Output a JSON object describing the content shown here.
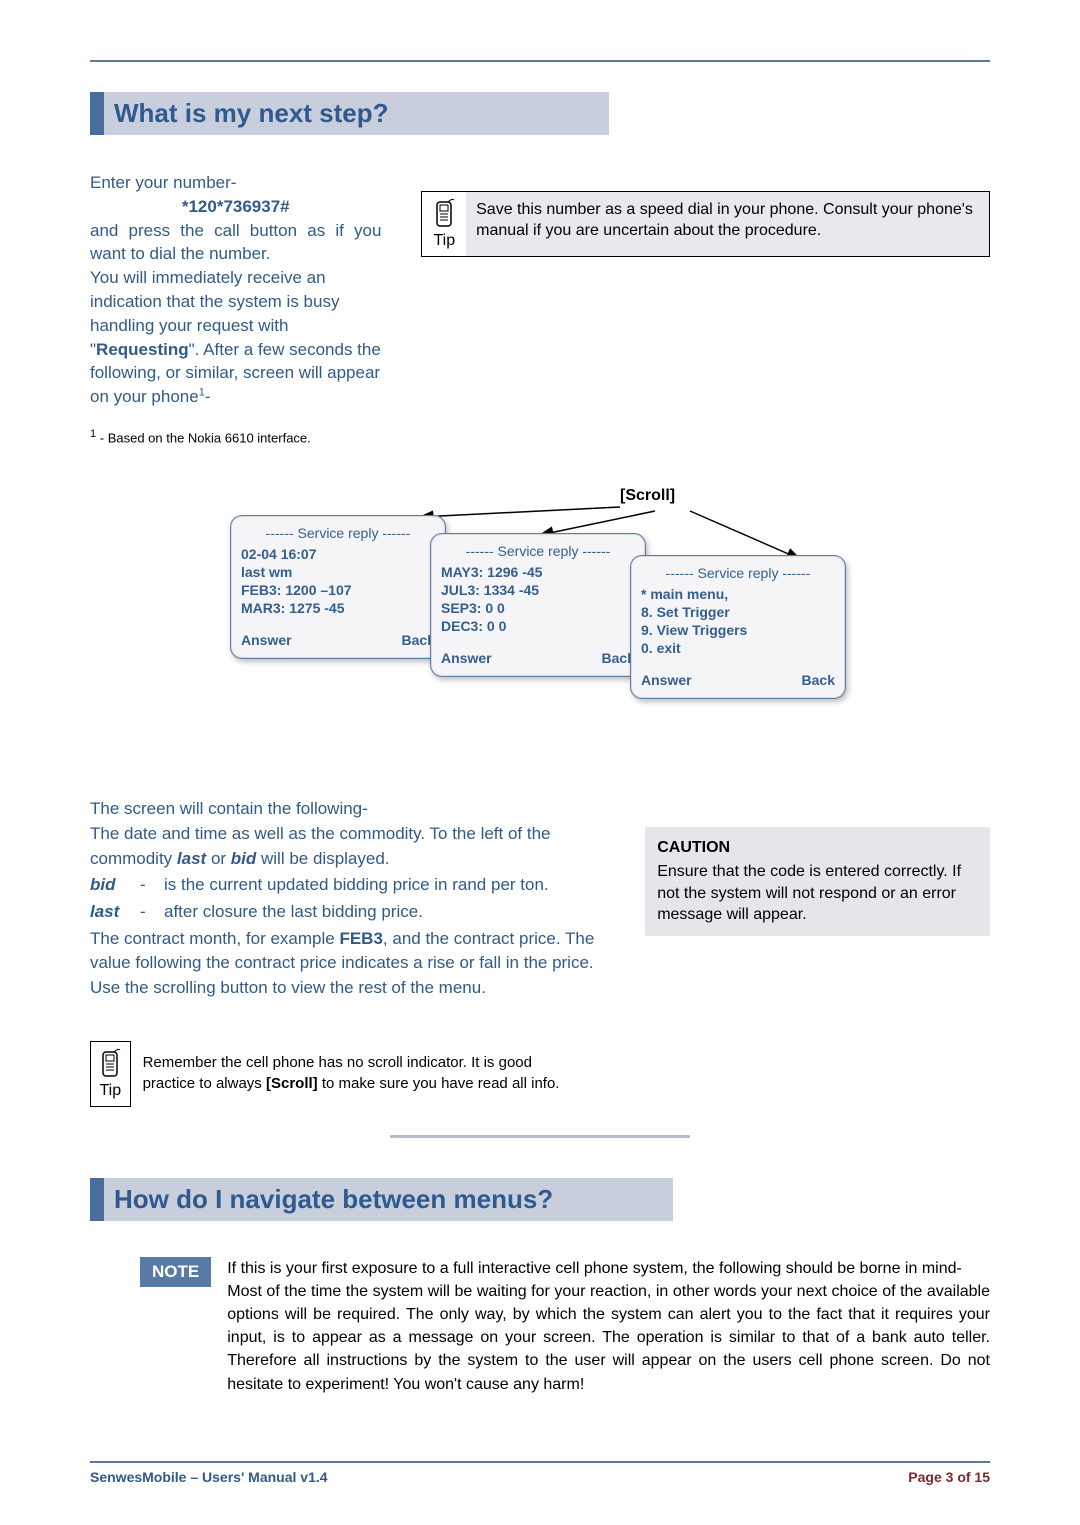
{
  "section1": {
    "title": "What is my next step?",
    "para1_line1": "Enter your number-",
    "dial_code": "*120*736937#",
    "para1_line2": "and press the call button as if you want to dial the number.",
    "para1_line3a": "You will immediately receive an indication that the system is busy handling your request with \"",
    "para1_line3b": "Requesting",
    "para1_line3c": "\". After a few seconds the following, or similar, screen will appear on your phone",
    "para1_sup": "1",
    "para1_tail": "-",
    "footnote": "- Based on the Nokia 6610 interface.",
    "footnote_sup": "1"
  },
  "tip1": {
    "label": "Tip",
    "body": "Save this number as a speed dial in your phone. Consult your phone's manual if you are uncertain about the procedure."
  },
  "scroll_label": "[Scroll]",
  "phone1": {
    "header": "------ Service reply ------",
    "lines": [
      "02-04 16:07",
      "last wm",
      "FEB3: 1200 –107",
      "MAR3: 1275 -45"
    ],
    "answer": "Answer",
    "back": "Back"
  },
  "phone2": {
    "header": "------ Service reply ------",
    "lines": [
      "MAY3: 1296 -45",
      "JUL3: 1334 -45",
      "SEP3: 0 0",
      "DEC3: 0 0"
    ],
    "answer": "Answer",
    "back": "Back"
  },
  "phone3": {
    "header": "------ Service reply ------",
    "lines": [
      "* main menu,",
      "8. Set Trigger",
      "9. View Triggers",
      "0. exit"
    ],
    "answer": "Answer",
    "back": "Back"
  },
  "desc": {
    "l1": "The screen will contain the following-",
    "l2a": "The date and time as well as the commodity. To the left of the commodity ",
    "l2_last": "last",
    "l2_or": " or ",
    "l2_bid": "bid",
    "l2b": " will be displayed.",
    "bid_key": "bid",
    "bid_val": "is the current updated bidding price in rand per ton.",
    "last_key": "last",
    "last_val": "after closure the last bidding price.",
    "l3a": "The contract month, for example ",
    "l3_feb": "FEB3",
    "l3b": ", and the contract price. The value following the contract price indicates a rise or fall in the price.",
    "l4": "Use the scrolling button to view the rest of the menu."
  },
  "caution": {
    "title": "CAUTION",
    "body": "Ensure that the code is entered correctly. If not the system will not respond or an error message will appear."
  },
  "tip2": {
    "label": "Tip",
    "body_a": "Remember the cell phone has no scroll indicator. It is good practice to always ",
    "scroll": "[Scroll]",
    "body_b": " to make sure you have read all info."
  },
  "section2": {
    "title": "How do I navigate between menus?"
  },
  "note": {
    "chip": "NOTE",
    "body": "If this is your first exposure to a full interactive cell phone system, the following should be borne in mind-\nMost of the time the system will be waiting for your reaction, in other words your next choice of the available options will be required. The only way, by which the system can alert you to the fact that it requires your input, is to appear as a message on your screen. The operation is similar to that of a bank auto teller. Therefore all instructions by the system to the user will appear on the users cell phone screen. Do not hesitate to experiment! You won't cause any harm!"
  },
  "footer": {
    "left": "SenwesMobile – Users' Manual v1.4",
    "right": "Page 3 of 15"
  }
}
